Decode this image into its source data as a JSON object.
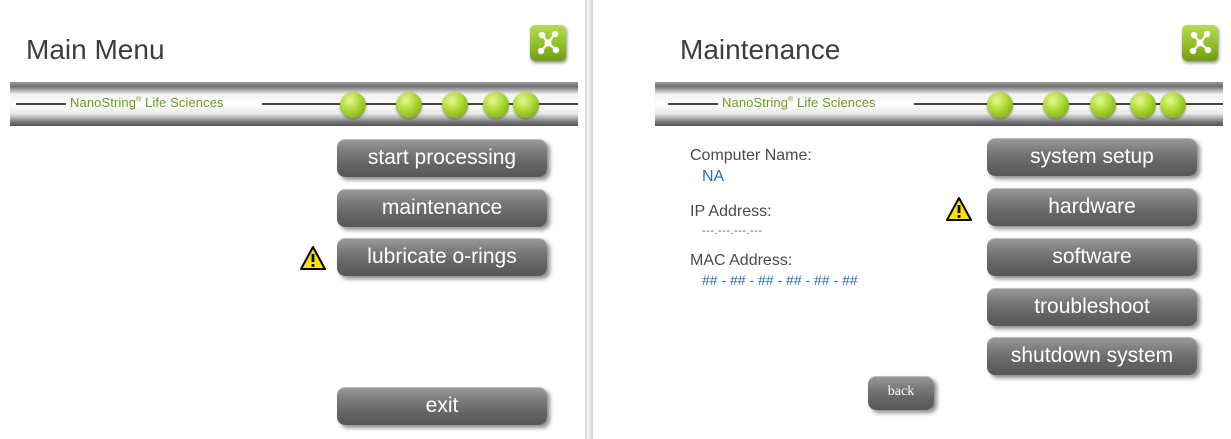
{
  "brand": {
    "name": "NanoString",
    "registered_mark": "®",
    "suffix": "Life Sciences",
    "logo_icon": "molecule-icon",
    "accent_color": "#8cbc24"
  },
  "main_menu": {
    "title": "Main Menu",
    "buttons": {
      "start_processing": "start processing",
      "maintenance": "maintenance",
      "lubricate_orings": "lubricate o-rings",
      "exit": "exit"
    },
    "warning_icon": "warning-icon"
  },
  "maintenance": {
    "title": "Maintenance",
    "info": {
      "computer_name_label": "Computer Name:",
      "computer_name_value": "NA",
      "ip_address_label": "IP Address:",
      "ip_address_value": "---.---.---.---",
      "mac_address_label": "MAC Address:",
      "mac_address_value": "## - ## - ## - ## - ## - ##"
    },
    "buttons": {
      "system_setup": "system setup",
      "hardware": "hardware",
      "software": "software",
      "troubleshoot": "troubleshoot",
      "shutdown_system": "shutdown system",
      "back": "back"
    },
    "warning_icon": "warning-icon"
  }
}
